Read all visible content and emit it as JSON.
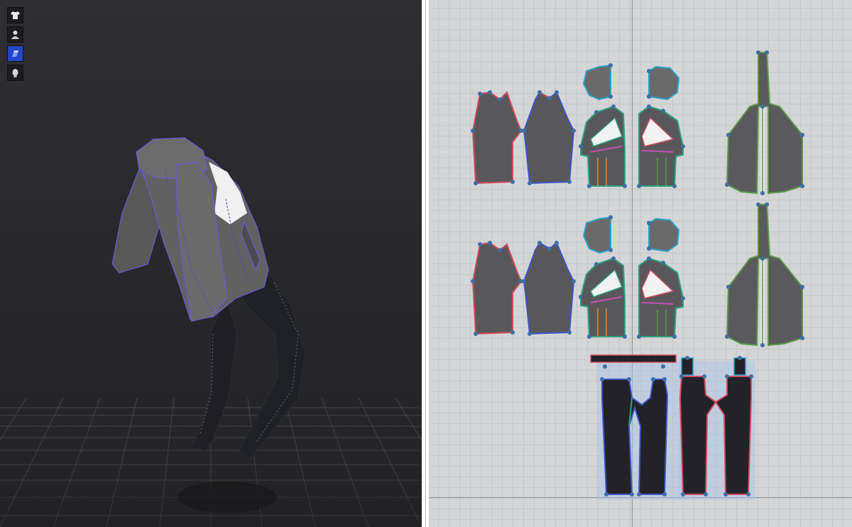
{
  "app": {
    "layout": "3d-view-and-2d-pattern-window"
  },
  "viewport3d": {
    "background": "#29292d",
    "floor_grid": "on",
    "toolbar": [
      {
        "id": "garment",
        "icon": "tshirt-icon",
        "active": false
      },
      {
        "id": "avatar",
        "icon": "avatar-bust-icon",
        "active": false
      },
      {
        "id": "fabric",
        "icon": "fabric-swatch-icon",
        "active": true
      },
      {
        "id": "avatar-head",
        "icon": "avatar-head-icon",
        "active": false
      }
    ],
    "garment_colors": {
      "jacket": "#5f5f60",
      "lining": "#f2f2f2",
      "pants": "#1e1e24",
      "seam": "#6a5bd6"
    }
  },
  "pattern2d": {
    "background": "#d4d5d7",
    "grid": "on",
    "piece_fill": "#5a5a5c",
    "piece_fill_pants": "#222228",
    "seam_colors": [
      "#d14a5d",
      "#3f55c8",
      "#2aa27d",
      "#5a9b4a",
      "#2aa3c7",
      "#c94fb8",
      "#e08a3a"
    ]
  }
}
